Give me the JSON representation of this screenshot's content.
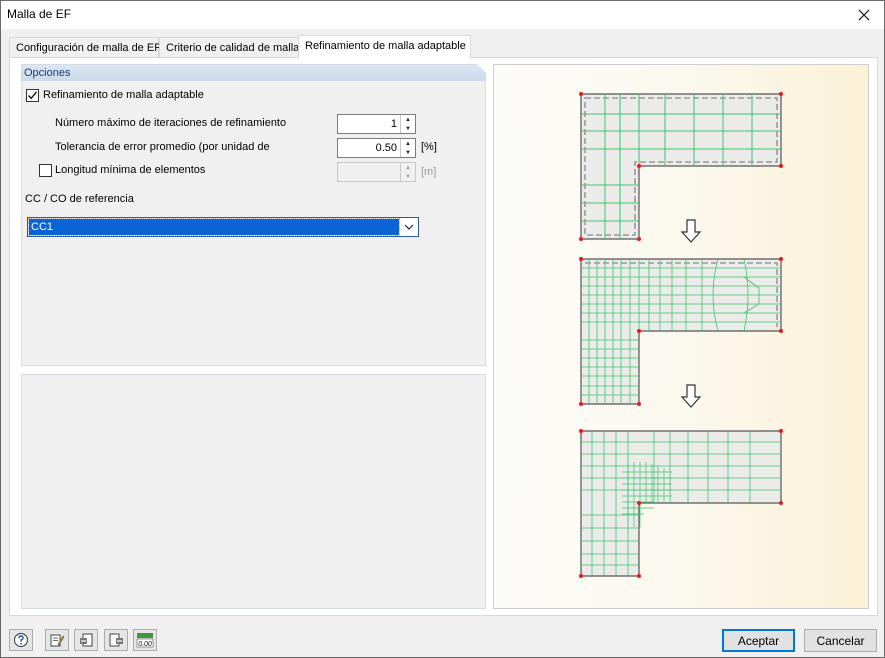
{
  "window": {
    "title": "Malla de EF"
  },
  "tabs": [
    {
      "label": "Configuración de malla de EF",
      "active": false
    },
    {
      "label": "Criterio de calidad de malla",
      "active": false
    },
    {
      "label": "Refinamiento de malla adaptable",
      "active": true
    }
  ],
  "options": {
    "header": "Opciones",
    "adaptive_refinement": {
      "label": "Refinamiento de malla adaptable",
      "checked": true
    },
    "max_iterations": {
      "label": "Número máximo de iteraciones de refinamiento",
      "value": "1"
    },
    "tolerance": {
      "label": "Tolerancia de error promedio (por unidad de",
      "value": "0.50",
      "unit": "[%]"
    },
    "min_length": {
      "label": "Longitud mínima de elementos",
      "checked": false,
      "value": "",
      "unit": "[m]"
    },
    "reference": {
      "label": "CC / CO de referencia",
      "selected": "CC1"
    }
  },
  "buttons": {
    "accept": "Aceptar",
    "cancel": "Cancelar"
  },
  "icons": [
    "help-icon",
    "edit-icon",
    "import-icon",
    "export-icon",
    "units-icon",
    "close-icon",
    "chevron-down-icon",
    "down-arrow-icon"
  ],
  "colors": {
    "mesh": "#3cc36a",
    "node": "#e8191b",
    "accent": "#0078d7",
    "selection": "#0a64d6"
  }
}
